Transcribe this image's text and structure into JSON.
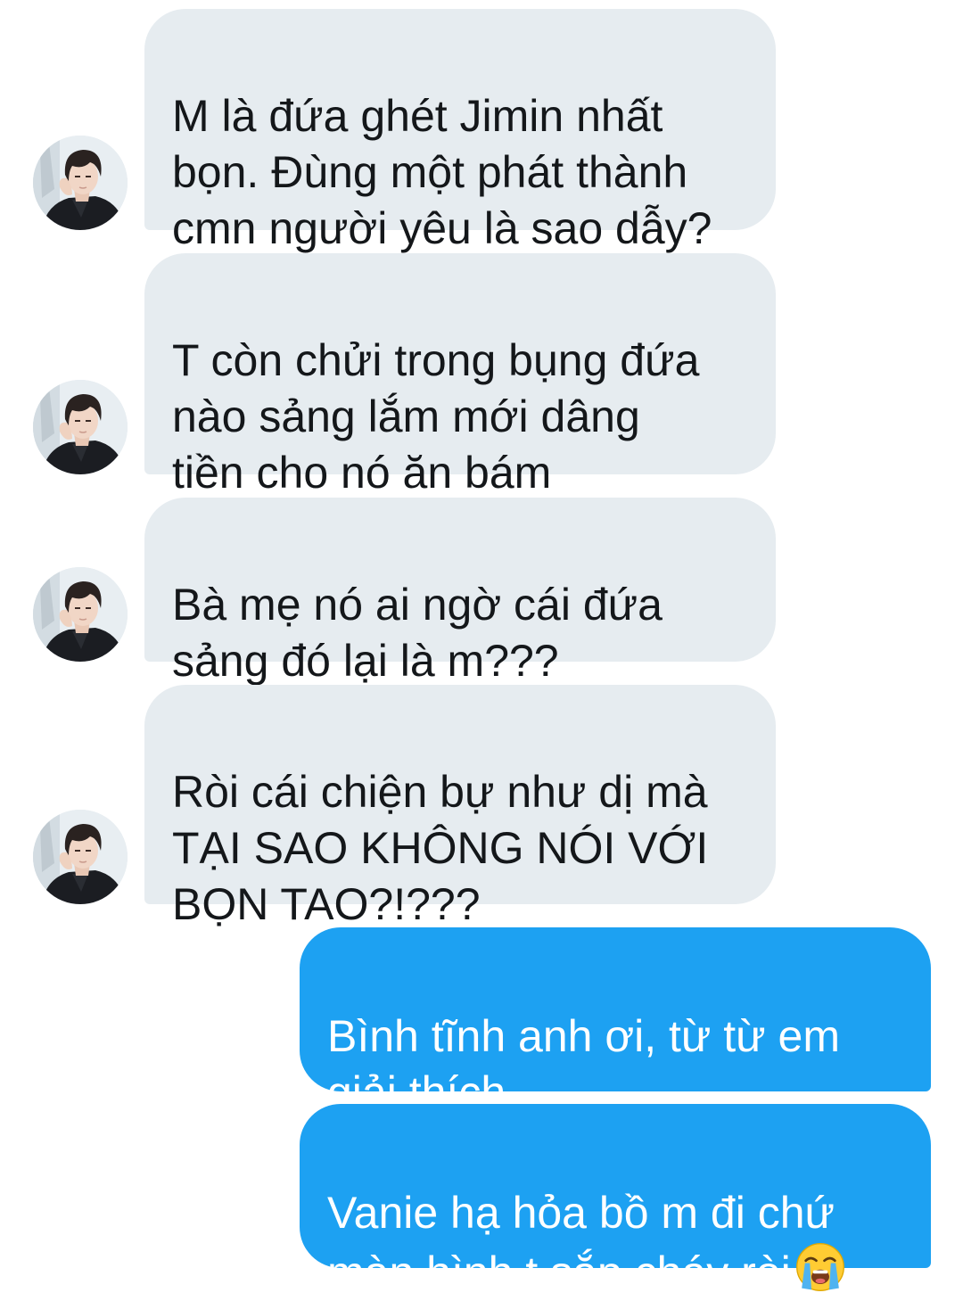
{
  "conversation": {
    "messages": [
      {
        "direction": "incoming",
        "text": "M là đứa ghét Jimin nhất\nbọn. Đùng một phát thành\ncmn người yêu là sao dẫy?",
        "avatar": "avatar-photo"
      },
      {
        "direction": "incoming",
        "text": "T còn chửi trong bụng đứa\nnào sảng lắm mới dâng\ntiền cho nó ăn bám",
        "avatar": "avatar-photo"
      },
      {
        "direction": "incoming",
        "text": "Bà mẹ nó ai ngờ cái đứa\nsảng đó lại là m???",
        "avatar": "avatar-photo"
      },
      {
        "direction": "incoming",
        "text": "Ròi cái chiện bự như dị mà\nTẠI SAO KHÔNG NÓI VỚI\nBỌN TAO?!???",
        "avatar": "avatar-photo"
      },
      {
        "direction": "outgoing",
        "text": "Bình tĩnh anh ơi, từ từ em\ngiải thích"
      },
      {
        "direction": "outgoing",
        "text": "Vanie hạ hỏa bồ m đi chứ\nmàn hình t sắp cháy ròi",
        "emoji": "loudly-crying-face-icon"
      }
    ]
  },
  "colors": {
    "incoming_bubble": "#e6ecf0",
    "incoming_text": "#14171a",
    "outgoing_bubble": "#1da1f2",
    "outgoing_text": "#ffffff",
    "background": "#ffffff"
  }
}
